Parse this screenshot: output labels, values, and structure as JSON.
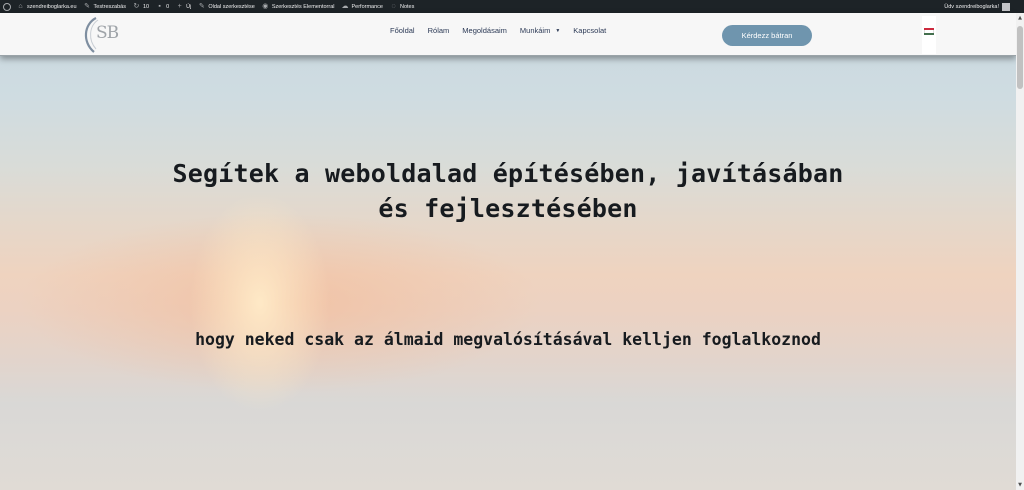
{
  "adminbar": {
    "site_name": "szendreiboglarka.eu",
    "customize": "Testreszabás",
    "updates_count": "10",
    "comments_count": "0",
    "new_label": "Új",
    "edit_page": "Oldal szerkesztése",
    "edit_elementor": "Szerkesztés Elementorral",
    "performance": "Performance",
    "notes": "Notes",
    "greeting": "Üdv szendreiboglarka!"
  },
  "header": {
    "logo_text": "SB",
    "nav": [
      {
        "label": "Főoldal"
      },
      {
        "label": "Rólam"
      },
      {
        "label": "Megoldásaim"
      },
      {
        "label": "Munkáim"
      },
      {
        "label": "Kapcsolat"
      }
    ],
    "cta_label": "Kérdezz bátran",
    "flag_colors": [
      "#cd2a3e",
      "#ffffff",
      "#436f4d"
    ]
  },
  "hero": {
    "headline": "Segítek a weboldalad építésében, javításában és fejlesztésében",
    "subline": "hogy neked csak az álmaid megvalósításával kelljen foglalkoznod"
  },
  "colors": {
    "admin_bar": "#1d2327",
    "cta_bg": "#6f95ae",
    "nav_text": "#2c3a56",
    "headline_text": "#171b1f"
  }
}
